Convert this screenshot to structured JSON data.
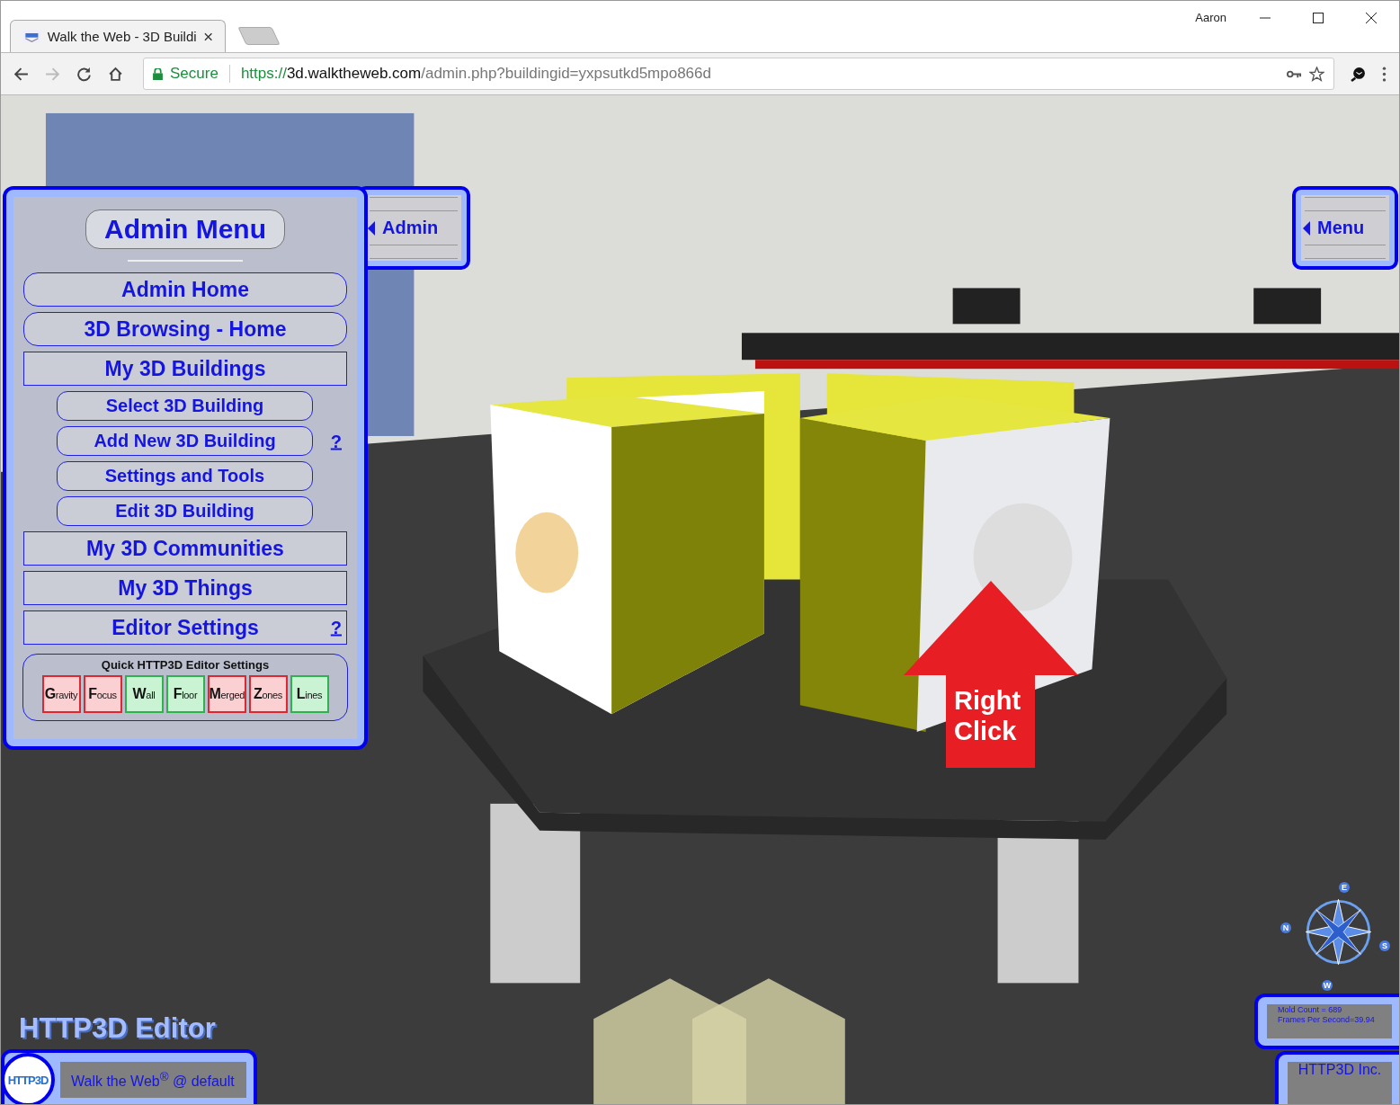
{
  "browser": {
    "user": "Aaron",
    "tab": {
      "title": "Walk the Web - 3D Buildi",
      "selected": true
    },
    "address": {
      "secure_label": "Secure",
      "scheme": "https://",
      "host": "3d.walktheweb.com",
      "path": "/admin.php?buildingid=yxpsutkd5mpo866d"
    }
  },
  "admin_toggle": {
    "label": "Admin"
  },
  "menu_toggle": {
    "label": "Menu"
  },
  "admin_menu": {
    "title": "Admin Menu",
    "items": [
      {
        "label": "Admin Home",
        "kind": "main"
      },
      {
        "label": "3D Browsing - Home",
        "kind": "main"
      },
      {
        "label": "My 3D Buildings",
        "kind": "section"
      },
      {
        "label": "Select 3D Building",
        "kind": "sub"
      },
      {
        "label": "Add New 3D Building",
        "kind": "sub",
        "help": "?"
      },
      {
        "label": "Settings and Tools",
        "kind": "sub"
      },
      {
        "label": "Edit 3D Building",
        "kind": "sub"
      },
      {
        "label": "My 3D Communities",
        "kind": "section"
      },
      {
        "label": "My 3D Things",
        "kind": "section"
      },
      {
        "label": "Editor Settings",
        "kind": "section",
        "help": "?"
      }
    ],
    "quick_settings": {
      "title": "Quick HTTP3D Editor Settings",
      "toggles": [
        {
          "label": "Gravity",
          "on": false
        },
        {
          "label": "Focus",
          "on": false
        },
        {
          "label": "Wall",
          "on": true
        },
        {
          "label": "Floor",
          "on": true
        },
        {
          "label": "Merged",
          "on": false
        },
        {
          "label": "Zones",
          "on": false
        },
        {
          "label": "Lines",
          "on": true
        }
      ]
    }
  },
  "annotation": {
    "text": "Right Click"
  },
  "compass": [
    "E",
    "N",
    "S",
    "W"
  ],
  "stats": [
    "Mold Count = 689",
    "Frames Per Second=39.94"
  ],
  "editor_title": "HTTP3D Editor",
  "footer": {
    "logo": "HTTP3D",
    "site": "Walk the Web",
    "mark": "®",
    "suffix": " @ default",
    "company": "HTTP3D Inc."
  }
}
